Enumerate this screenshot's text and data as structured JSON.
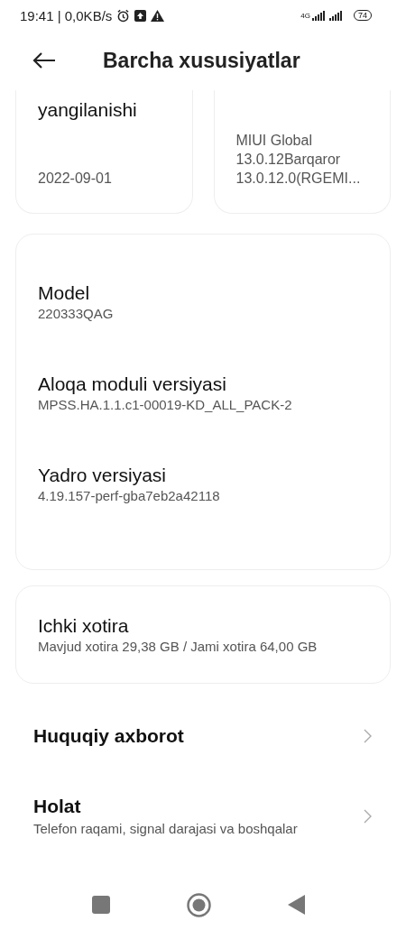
{
  "status_bar": {
    "time": "19:41 | 0,0KB/s",
    "network": "4G",
    "battery": "74"
  },
  "header": {
    "title": "Barcha xususiyatlar"
  },
  "top_cards": [
    {
      "title": "yangilanishi",
      "value": "2022-09-01"
    },
    {
      "value": "MIUI Global\n13.0.12Barqaror\n13.0.12.0(RGEMI..."
    }
  ],
  "info_card": [
    {
      "label": "Model",
      "value": "220333QAG"
    },
    {
      "label": "Aloqa moduli versiyasi",
      "value": "MPSS.HA.1.1.c1-00019-KD_ALL_PACK-2"
    },
    {
      "label": "Yadro versiyasi",
      "value": "4.19.157-perf-gba7eb2a42118"
    }
  ],
  "storage_card": {
    "label": "Ichki xotira",
    "value": "Mavjud xotira 29,38 GB / Jami xotira 64,00 GB"
  },
  "rows": [
    {
      "title": "Huquqiy axborot"
    },
    {
      "title": "Holat",
      "subtitle": "Telefon raqami, signal darajasi va boshqalar"
    }
  ]
}
